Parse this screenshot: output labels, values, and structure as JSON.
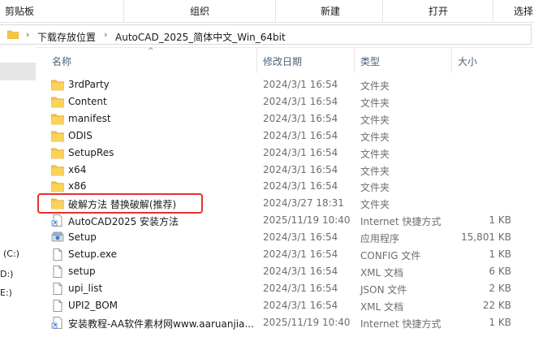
{
  "ribbon": {
    "groups": [
      "剪贴板",
      "组织",
      "新建",
      "打开",
      "选择"
    ]
  },
  "address": {
    "crumbs": [
      "下载存放位置",
      "AutoCAD_2025_简体中文_Win_64bit"
    ]
  },
  "nav": {
    "drives": [
      "(C:)",
      "D:)",
      "E:)"
    ]
  },
  "columns": {
    "name": "名称",
    "date": "修改日期",
    "type": "类型",
    "size": "大小"
  },
  "files": [
    {
      "name": "3rdParty",
      "date": "2024/3/1 16:54",
      "type": "文件夹",
      "size": "",
      "icon": "folder-icon"
    },
    {
      "name": "Content",
      "date": "2024/3/1 16:54",
      "type": "文件夹",
      "size": "",
      "icon": "folder-icon"
    },
    {
      "name": "manifest",
      "date": "2024/3/1 16:54",
      "type": "文件夹",
      "size": "",
      "icon": "folder-icon"
    },
    {
      "name": "ODIS",
      "date": "2024/3/1 16:54",
      "type": "文件夹",
      "size": "",
      "icon": "folder-icon"
    },
    {
      "name": "SetupRes",
      "date": "2024/3/1 16:54",
      "type": "文件夹",
      "size": "",
      "icon": "folder-icon"
    },
    {
      "name": "x64",
      "date": "2024/3/1 16:54",
      "type": "文件夹",
      "size": "",
      "icon": "folder-icon"
    },
    {
      "name": "x86",
      "date": "2024/3/1 16:54",
      "type": "文件夹",
      "size": "",
      "icon": "folder-icon"
    },
    {
      "name": "破解方法 替换破解(推荐)",
      "date": "2024/3/27 18:31",
      "type": "文件夹",
      "size": "",
      "icon": "folder-icon"
    },
    {
      "name": "AutoCAD2025 安装方法",
      "date": "2025/11/19 10:40",
      "type": "Internet 快捷方式",
      "size": "1 KB",
      "icon": "shortcut-icon"
    },
    {
      "name": "Setup",
      "date": "2024/3/1 16:54",
      "type": "应用程序",
      "size": "15,801 KB",
      "icon": "setup-app-icon"
    },
    {
      "name": "Setup.exe",
      "date": "2024/3/1 16:54",
      "type": "CONFIG 文件",
      "size": "1 KB",
      "icon": "document-icon"
    },
    {
      "name": "setup",
      "date": "2024/3/1 16:54",
      "type": "XML 文档",
      "size": "6 KB",
      "icon": "document-icon"
    },
    {
      "name": "upi_list",
      "date": "2024/3/1 16:54",
      "type": "JSON 文件",
      "size": "2 KB",
      "icon": "document-icon"
    },
    {
      "name": "UPI2_BOM",
      "date": "2024/3/1 16:54",
      "type": "XML 文档",
      "size": "22 KB",
      "icon": "document-icon"
    },
    {
      "name": "安装教程-AA软件素材网www.aaruanjia...",
      "date": "2025/11/19 10:40",
      "type": "Internet 快捷方式",
      "size": "1 KB",
      "icon": "shortcut-icon"
    }
  ],
  "colors": {
    "folder": "#f6c445",
    "highlight": "#e8302e",
    "header_text": "#4c607a"
  }
}
